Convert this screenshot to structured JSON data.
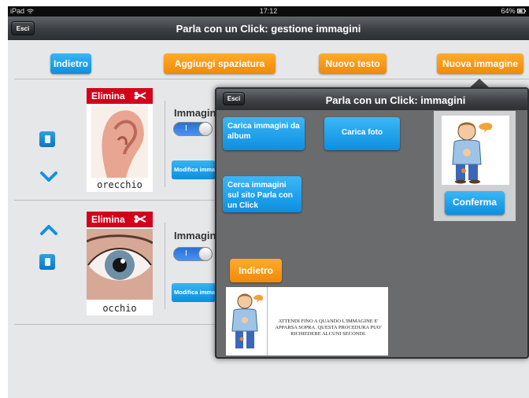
{
  "status_bar": {
    "device": "iPad",
    "time": "17:12",
    "battery": "64%"
  },
  "header": {
    "exit_label": "Esci",
    "title": "Parla con un Click: gestione immagini"
  },
  "toolbar": {
    "back_label": "Indietro",
    "add_spacing_label": "Aggiungi spaziatura",
    "new_text_label": "Nuovo testo",
    "new_image_label": "Nuova immagine"
  },
  "items": [
    {
      "delete_label": "Elimina",
      "word": "orecchio",
      "image_label": "Immagine",
      "toggle_text": "I",
      "modify_label": "Modifica immagine"
    },
    {
      "delete_label": "Elimina",
      "word": "occhio",
      "image_label": "Immagine",
      "toggle_text": "I",
      "modify_label": "Modifica immagine"
    }
  ],
  "modal": {
    "exit_label": "Esci",
    "title": "Parla con un Click: immagini",
    "load_album_label": "Carica immagini da album",
    "load_photo_label": "Carica foto",
    "search_site_label": "Cerca immagini sul sito Parla con un Click",
    "confirm_label": "Conferma",
    "back_label": "Indietro",
    "wait_message": "ATTENDI FINO A QUANDO L'IMMAGINE E' APPARSA SOPRA. QUESTA PROCEDURA PUO' RICHIEDERE ALCUNI SECONDI."
  },
  "colors": {
    "blue": "#0d8fe0",
    "orange": "#f18a06",
    "red": "#d3001c",
    "background": "#e6e7e9"
  },
  "icons": [
    "wifi-icon",
    "battery-icon",
    "scissors-icon",
    "document-icon",
    "chevron-down-icon",
    "chevron-up-icon",
    "speech-bubble-icon"
  ]
}
